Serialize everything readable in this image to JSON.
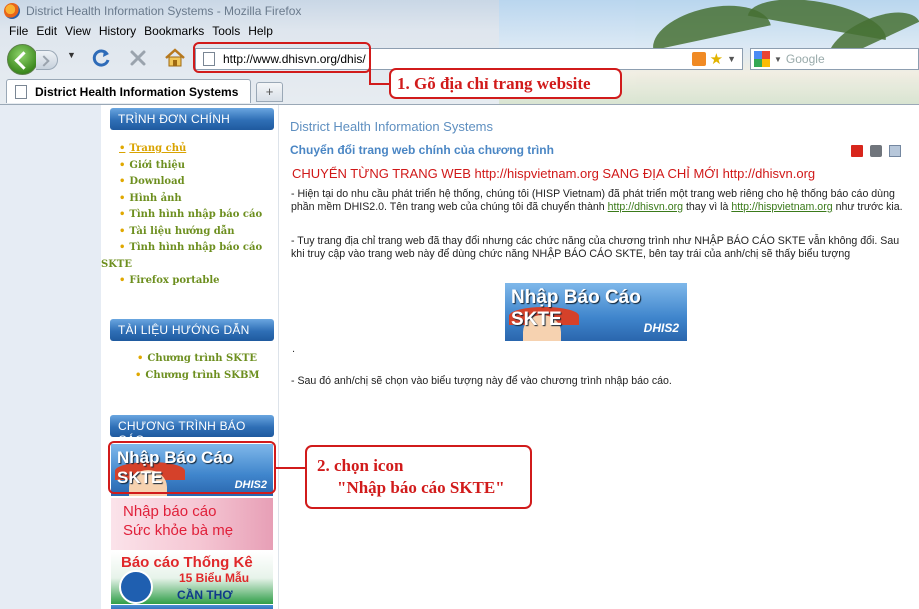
{
  "window": {
    "title": "District Health Information Systems - Mozilla Firefox"
  },
  "menu": [
    "File",
    "Edit",
    "View",
    "History",
    "Bookmarks",
    "Tools",
    "Help"
  ],
  "address_bar": {
    "url": "http://www.dhisvn.org/dhis/"
  },
  "search_bar": {
    "placeholder": "Google"
  },
  "tab": {
    "label": "District Health Information Systems",
    "new_tab_symbol": "+"
  },
  "sidebar": {
    "main_menu_title": "TRÌNH ĐƠN CHÍNH",
    "main_menu_items": [
      "Trang chủ",
      "Giới thiệu",
      "Download",
      "Hình ảnh",
      "Tình hình nhập báo cáo",
      "Tài liệu hướng dẫn",
      "Tình hình nhập báo cáo",
      "SKTE",
      "Firefox portable"
    ],
    "guide_title": "TÀI LIỆU HƯỚNG DẪN",
    "guide_items": [
      "Chương trình SKTE",
      "Chương trình SKBM"
    ],
    "report_title": "CHƯƠNG TRÌNH BÁO CÁO",
    "banner_skte": {
      "text": "Nhập Báo Cáo SKTE",
      "logo": "DHIS2"
    },
    "banner_skbm": {
      "line1": "Nhập báo cáo",
      "line2": "Sức khỏe bà mẹ"
    },
    "banner_ct": {
      "line1": "Báo cáo Thống Kê",
      "line2": "15 Biểu Mẫu",
      "line3": "CẦN THƠ"
    }
  },
  "content": {
    "site_title": "District Health Information Systems",
    "article_title": "Chuyển đổi trang web chính của chương trình",
    "headline": "CHUYỂN TỪNG TRANG WEB http://hispvietnam.org SANG ĐỊA CHỈ MỚI http://dhisvn.org",
    "para1_a": "- Hiện tại do nhu cầu phát triển hệ thống, chúng tôi (HISP Vietnam) đã phát triển một trang web riêng cho hệ thống báo cáo dùng phần mềm DHIS2.0. Tên trang web của chúng tôi đã chuyển thành ",
    "para1_link1": "http://dhisvn.org",
    "para1_b": " thay vì là ",
    "para1_link2": "http://hispvietnam.org",
    "para1_c": " như trước kia.",
    "para2": "- Tuy trang địa chỉ trang web đã thay đổi nhưng các chức năng của chương trình như NHẬP BÁO CÁO SKTE vẫn không đổi. Sau khi truy cập vào trang web này để dùng chức năng NHẬP BÁO CÁO SKTE, bên tay trái của anh/chị sẽ thấy biểu tượng",
    "center_banner": {
      "text": "Nhập Báo Cáo SKTE",
      "logo": "DHIS2"
    },
    "dot": ".",
    "para3": "- Sau đó anh/chị sẽ chọn vào biểu tượng này để vào chương trình nhập báo cáo."
  },
  "annotations": {
    "step1": "1. Gõ địa chỉ trang website",
    "step2_line1": "2. chọn icon",
    "step2_line2": "\"Nhập báo cáo SKTE\""
  },
  "colors": {
    "annotation": "#d11b1b",
    "headline": "#d01818",
    "menu_link": "#6d8f1f",
    "header_blue": "#2f6fb6"
  }
}
